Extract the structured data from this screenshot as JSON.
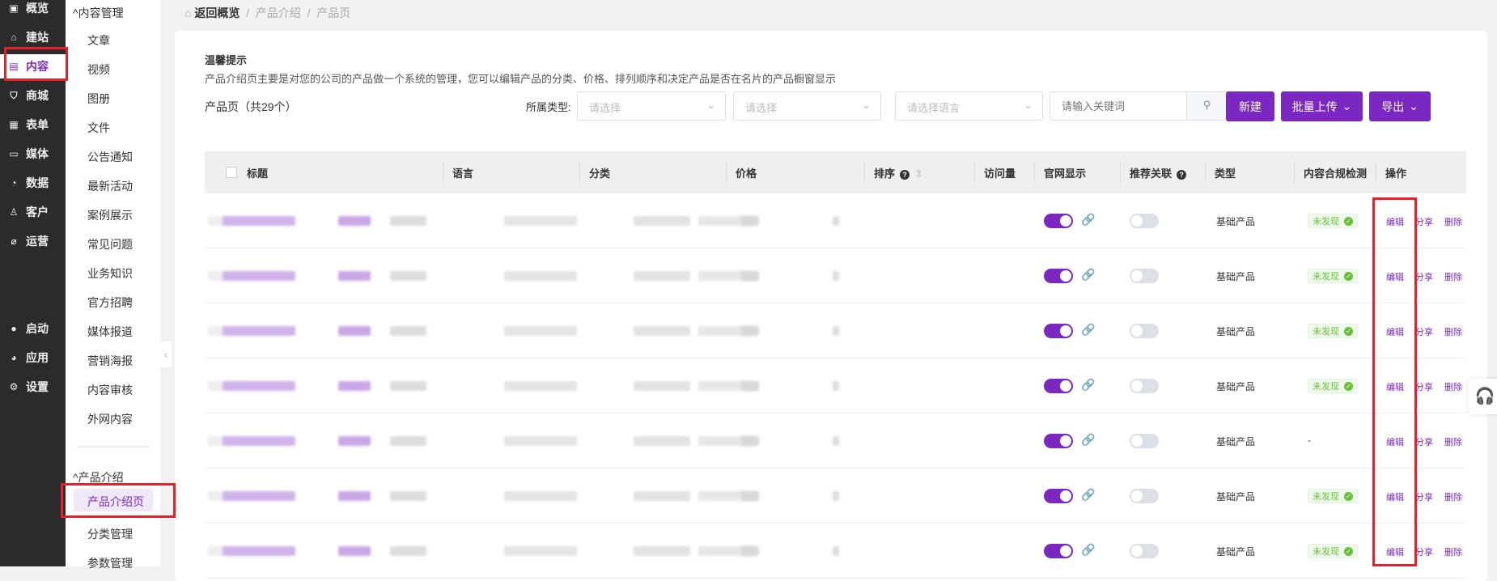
{
  "nav_primary": [
    {
      "label": "概览",
      "icon": "overview-icon"
    },
    {
      "label": "建站",
      "icon": "home-icon"
    },
    {
      "label": "内容",
      "icon": "document-icon",
      "active": true
    },
    {
      "label": "商城",
      "icon": "cart-icon"
    },
    {
      "label": "表单",
      "icon": "form-icon"
    },
    {
      "label": "媒体",
      "icon": "video-icon"
    },
    {
      "label": "数据",
      "icon": "chart-icon"
    },
    {
      "label": "客户",
      "icon": "user-icon"
    },
    {
      "label": "运营",
      "icon": "paperclip-icon"
    },
    {
      "label": "启动",
      "icon": "launch-icon"
    },
    {
      "label": "应用",
      "icon": "apps-icon"
    },
    {
      "label": "设置",
      "icon": "gear-icon"
    }
  ],
  "nav_secondary": {
    "group1": "内容管理",
    "group1_items": [
      "文章",
      "视频",
      "图册",
      "文件",
      "公告通知",
      "最新活动",
      "案例展示",
      "常见问题",
      "业务知识",
      "官方招聘",
      "媒体报道",
      "营销海报",
      "内容审核",
      "外网内容"
    ],
    "group2": "产品介绍",
    "group2_items": [
      "产品介绍页",
      "分类管理",
      "参数管理"
    ]
  },
  "breadcrumb": {
    "home": "返回概览",
    "sep": "/",
    "level1": "产品介绍",
    "level2": "产品页"
  },
  "tip": {
    "title": "温馨提示",
    "text": "产品介绍页主要是对您的公司的产品做一个系统的管理，您可以编辑产品的分类、价格、排列顺序和决定产品是否在名片的产品橱窗显示"
  },
  "list_title": "产品页（共29个）",
  "filters": {
    "type_label": "所属类型:",
    "select1": "请选择",
    "select2": "请选择",
    "language": "请选择语言",
    "keyword_placeholder": "请输入关键词"
  },
  "buttons": {
    "new": "新建",
    "batch_upload": "批量上传",
    "export": "导出"
  },
  "table": {
    "headers": [
      "标题",
      "语言",
      "分类",
      "价格",
      "排序",
      "访问量",
      "官网显示",
      "推荐关联",
      "类型",
      "内容合规检测",
      "操作"
    ],
    "rows": [
      {
        "type": "基础产品",
        "compliance": "未发现",
        "site_display": true,
        "recommend": false
      },
      {
        "type": "基础产品",
        "compliance": "未发现",
        "site_display": true,
        "recommend": false
      },
      {
        "type": "基础产品",
        "compliance": "未发现",
        "site_display": true,
        "recommend": false
      },
      {
        "type": "基础产品",
        "compliance": "未发现",
        "site_display": true,
        "recommend": false
      },
      {
        "type": "基础产品",
        "compliance": "-",
        "site_display": true,
        "recommend": false
      },
      {
        "type": "基础产品",
        "compliance": "未发现",
        "site_display": true,
        "recommend": false
      },
      {
        "type": "基础产品",
        "compliance": "未发现",
        "site_display": true,
        "recommend": false
      }
    ],
    "actions": {
      "edit": "编辑",
      "share": "分享",
      "delete": "删除"
    }
  },
  "colors": {
    "accent": "#7b27c2",
    "highlight": "#e8202a",
    "success": "#67c23a"
  }
}
